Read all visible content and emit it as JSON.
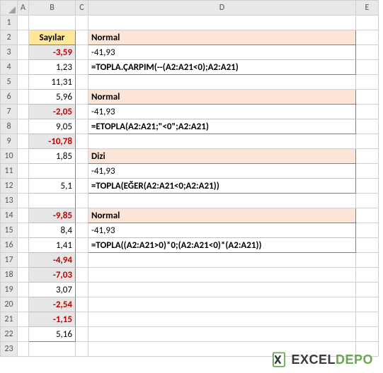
{
  "columns": [
    "A",
    "B",
    "C",
    "D",
    "E"
  ],
  "rows": [
    "1",
    "2",
    "3",
    "4",
    "5",
    "6",
    "7",
    "8",
    "9",
    "10",
    "11",
    "12",
    "13",
    "14",
    "15",
    "16",
    "17",
    "18",
    "19",
    "20",
    "21",
    "22",
    "23"
  ],
  "b_header": "Sayılar",
  "numbers": [
    {
      "v": "-3,59",
      "neg": true
    },
    {
      "v": "1,23",
      "neg": false
    },
    {
      "v": "11,31",
      "neg": false
    },
    {
      "v": "5,96",
      "neg": false
    },
    {
      "v": "-2,05",
      "neg": true
    },
    {
      "v": "9,05",
      "neg": false
    },
    {
      "v": "-10,78",
      "neg": true
    },
    {
      "v": "1,85",
      "neg": false
    },
    {
      "v": "",
      "neg": false
    },
    {
      "v": "5,1",
      "neg": false
    },
    {
      "v": "",
      "neg": false
    },
    {
      "v": "-9,85",
      "neg": true
    },
    {
      "v": "8,4",
      "neg": false
    },
    {
      "v": "1,41",
      "neg": false
    },
    {
      "v": "-4,94",
      "neg": true
    },
    {
      "v": "-7,03",
      "neg": true
    },
    {
      "v": "3,07",
      "neg": false
    },
    {
      "v": "-2,54",
      "neg": true
    },
    {
      "v": "-1,15",
      "neg": true
    },
    {
      "v": "5,16",
      "neg": false
    }
  ],
  "blocks": [
    {
      "row": 2,
      "title": "Normal",
      "value": "-41,93",
      "formula": "=TOPLA.ÇARPIM(--(A2:A21<0);A2:A21)"
    },
    {
      "row": 6,
      "title": "Normal",
      "value": "-41,93",
      "formula": "=ETOPLA(A2:A21;\"<0\";A2:A21)"
    },
    {
      "row": 10,
      "title": "Dizi",
      "value": "-41,93",
      "formula": "=TOPLA(EĞER(A2:A21<0;A2:A21))"
    },
    {
      "row": 14,
      "title": "Normal",
      "value": "-41,93",
      "formula": "=TOPLA((A2:A21>0)*0;(A2:A21<0)*(A2:A21))"
    }
  ],
  "logo": {
    "brand": "EXCEL",
    "suffix": "DEPO"
  }
}
